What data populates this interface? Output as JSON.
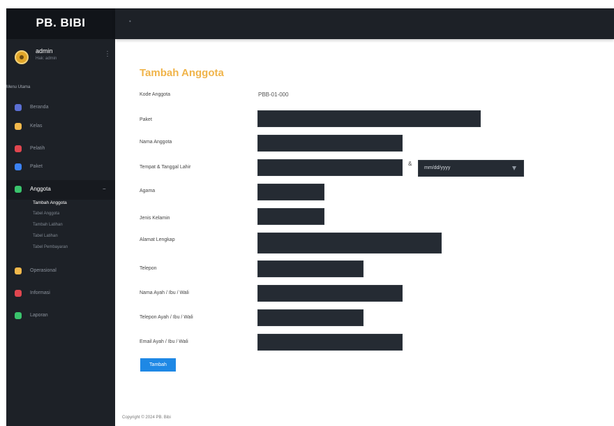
{
  "brand": {
    "name": "PB. BIBI"
  },
  "user": {
    "name": "admin",
    "role": "Hak: admin"
  },
  "sidebar": {
    "menu_header": "Menu Utama",
    "items": [
      {
        "label": "Beranda"
      },
      {
        "label": "Kelas"
      },
      {
        "label": "Pelatih"
      },
      {
        "label": "Paket"
      },
      {
        "label": "Anggota"
      },
      {
        "label": "Operasional"
      },
      {
        "label": "Informasi"
      },
      {
        "label": "Laporan"
      }
    ],
    "sub_items": [
      {
        "label": "Tambah Anggota"
      },
      {
        "label": "Tabel Anggota"
      },
      {
        "label": "Tambah Latihan"
      },
      {
        "label": "Tabel Latihan"
      },
      {
        "label": "Tabel Pembayaran"
      }
    ]
  },
  "form": {
    "title": "Tambah Anggota",
    "fields": [
      {
        "label": "Kode Anggota",
        "value": "PBB-01-000"
      },
      {
        "label": "Paket",
        "placeholder": ""
      },
      {
        "label": "Nama Anggota",
        "placeholder": ""
      },
      {
        "label": "Tempat & Tanggal Lahir",
        "placeholder": ""
      },
      {
        "label": "Agama",
        "placeholder": ""
      },
      {
        "label": "Jenis Kelamin",
        "placeholder": ""
      },
      {
        "label": "Alamat Lengkap",
        "placeholder": ""
      },
      {
        "label": "Telepon",
        "placeholder": ""
      },
      {
        "label": "Nama Ayah / Ibu / Wali",
        "placeholder": ""
      },
      {
        "label": "Telepon Ayah / Ibu / Wali",
        "placeholder": ""
      },
      {
        "label": "Email Ayah / Ibu / Wali",
        "placeholder": ""
      }
    ],
    "date_separator": "&",
    "date_placeholder": "mm/dd/yyyy",
    "submit_label": "Tambah"
  },
  "footer": {
    "text": "Copyright © 2024 PB. Bibi"
  },
  "colors": {
    "accent": "#f0b44a",
    "sidebar": "#1d2127",
    "button": "#1e88e5"
  },
  "icons": [
    "toggle-icon",
    "avatar-icon",
    "caret-icon",
    "calendar-caret-icon"
  ]
}
